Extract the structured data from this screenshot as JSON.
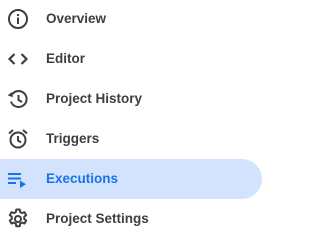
{
  "sidebar": {
    "items": [
      {
        "label": "Overview",
        "icon": "info-icon"
      },
      {
        "label": "Editor",
        "icon": "code-icon"
      },
      {
        "label": "Project History",
        "icon": "history-icon"
      },
      {
        "label": "Triggers",
        "icon": "alarm-clock-icon"
      },
      {
        "label": "Executions",
        "icon": "playlist-play-icon",
        "active": true
      },
      {
        "label": "Project Settings",
        "icon": "gear-icon"
      }
    ]
  },
  "colors": {
    "text": "#3c4043",
    "icon": "#3c4043",
    "active_text": "#1a73e8",
    "active_icon": "#1a73e8",
    "active_background": "#d3e3fd"
  }
}
